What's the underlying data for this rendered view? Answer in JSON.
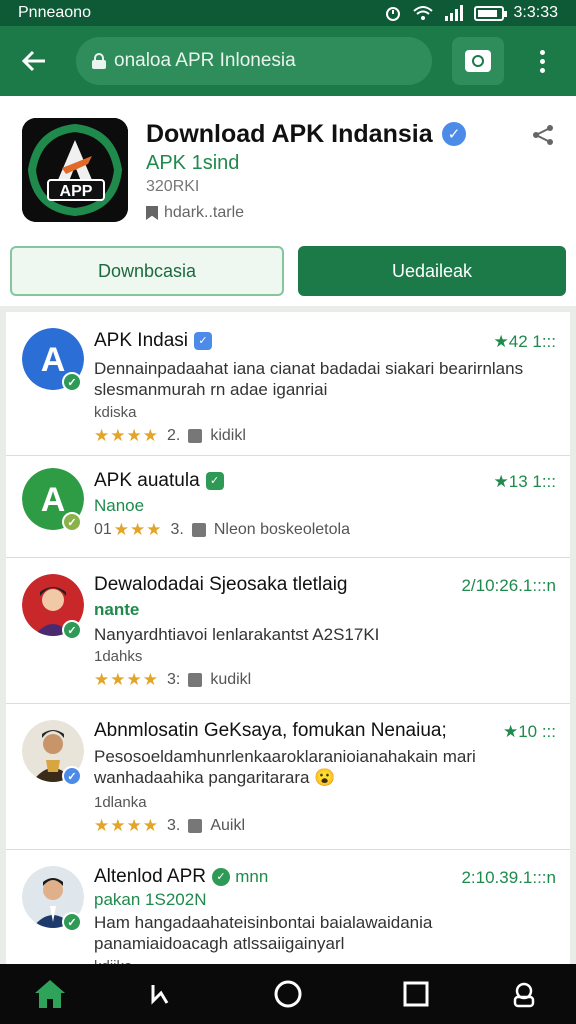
{
  "status_bar": {
    "carrier": "Pnneaono",
    "time": "3:3:33",
    "battery_level": 0.75
  },
  "toolbar": {
    "url_text": "onaloa APR Inlonesia"
  },
  "app": {
    "title": "Download APK Indansia",
    "developer": "APK 1sind",
    "size": "320RKI",
    "tag": "hdark..tarle",
    "icon_label": "APP",
    "btn_left": "Downbcasia",
    "btn_right": "Uedaileak"
  },
  "reviews": [
    {
      "name": "APK Indasi",
      "meta": "★42 1:::",
      "text": "Dennainpadaahat iana cianat badadai siakari bearirnlans slesmanmurah rn adae iganriai",
      "text2": "kdiska",
      "stars": "★★★★",
      "rating": "2.",
      "helpful": "kidikl",
      "avatar_letter": "A"
    },
    {
      "name": "APK auatula",
      "meta": "★13 1:::",
      "sub": "Nanoe",
      "foot_prefix": "01",
      "stars": "★★★",
      "rating": "3.",
      "helpful": "Nleon boskeoletola",
      "avatar_letter": "A"
    },
    {
      "name": "Dewalodadai Sjeosaka tletlaig",
      "meta": "2/10:26.1:::n",
      "sub": "nante",
      "text": "Nanyardhtiavoi lenlarakantst A2S17KI",
      "text2": "1dahks",
      "stars": "★★★★",
      "rating": "3:",
      "helpful": "kudikl"
    },
    {
      "name": "Abnmlosatin GeKsaya, fomukan Nenaiua;",
      "meta": "★10 :::",
      "text": "Pesosoeldamhunrlenkaaroklaranioianahakain mari wanhadaahika pangaritarara 😮",
      "text2": "1dlanka",
      "stars": "★★★★",
      "rating": "3.",
      "helpful": "Auikl"
    },
    {
      "name": "Altenlod APR",
      "name_suffix": "mnn",
      "meta": "2:10.39.1:::n",
      "sub": "pakan 1S202N",
      "text": "Ham hangadaahateisinbontai baialawaidania panamiaidoacagh atlssaiigainyarl",
      "text2": "kdiika"
    }
  ],
  "colors": {
    "primary": "#1b7a47",
    "accent": "#1f8a4c",
    "star": "#e2a528",
    "verified": "#4d8be8"
  },
  "icons": [
    "back-arrow-icon",
    "lock-icon",
    "camera-icon",
    "more-vert-icon",
    "verified-icon",
    "share-icon",
    "home-icon",
    "back-nav-icon",
    "circle-icon",
    "square-icon",
    "profile-icon"
  ]
}
